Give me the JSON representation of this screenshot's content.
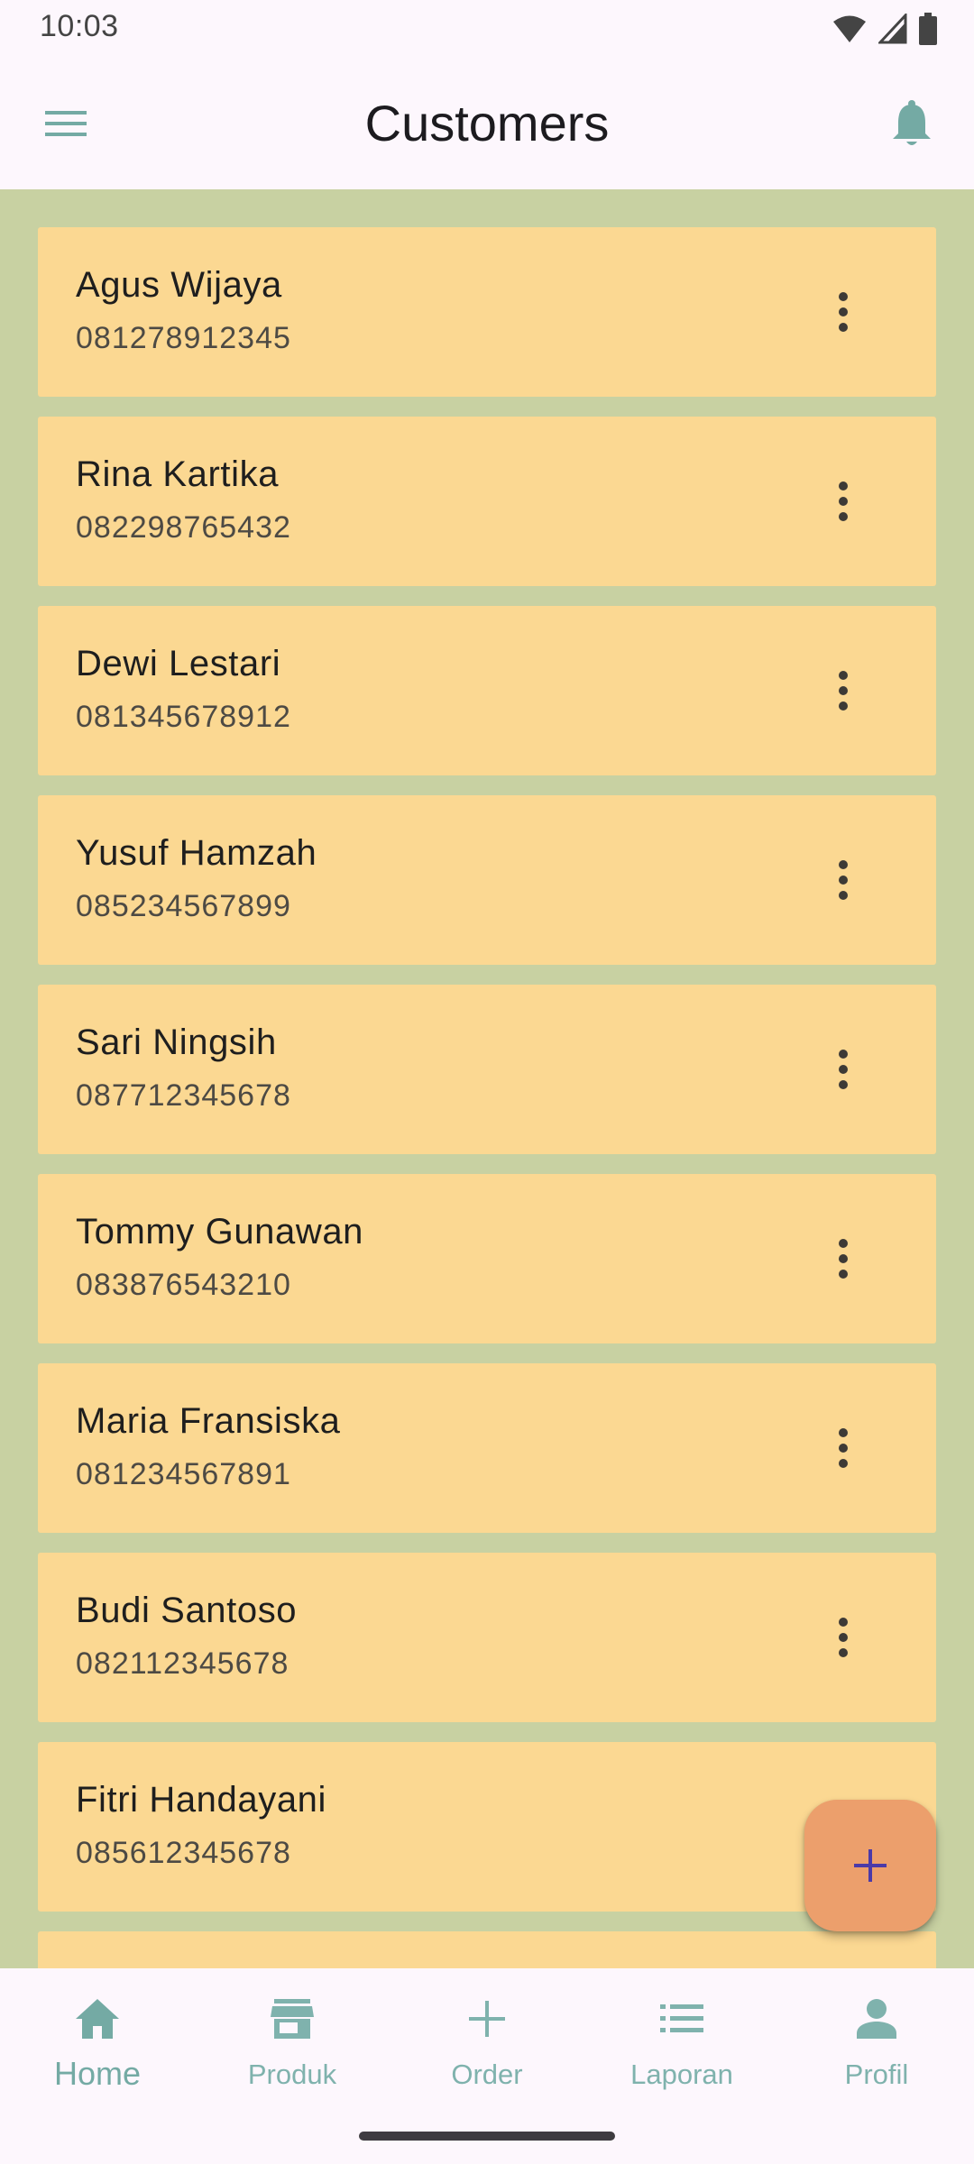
{
  "status_bar": {
    "time": "10:03"
  },
  "app_bar": {
    "title": "Customers"
  },
  "customers": [
    {
      "name": "Agus Wijaya",
      "phone": "081278912345"
    },
    {
      "name": "Rina Kartika",
      "phone": "082298765432"
    },
    {
      "name": "Dewi Lestari",
      "phone": "081345678912"
    },
    {
      "name": "Yusuf Hamzah",
      "phone": "085234567899"
    },
    {
      "name": "Sari Ningsih",
      "phone": "087712345678"
    },
    {
      "name": "Tommy Gunawan",
      "phone": "083876543210"
    },
    {
      "name": "Maria Fransiska",
      "phone": "081234567891"
    },
    {
      "name": "Budi Santoso",
      "phone": "082112345678"
    },
    {
      "name": "Fitri Handayani",
      "phone": "085612345678"
    },
    {
      "name": "",
      "phone": ""
    }
  ],
  "fab": {
    "icon": "plus-icon"
  },
  "bottom_nav": {
    "items": [
      {
        "label": "Home",
        "icon": "home-icon",
        "active": true
      },
      {
        "label": "Produk",
        "icon": "store-icon",
        "active": false
      },
      {
        "label": "Order",
        "icon": "plus-icon",
        "active": false
      },
      {
        "label": "Laporan",
        "icon": "list-icon",
        "active": false
      },
      {
        "label": "Profil",
        "icon": "person-icon",
        "active": false
      }
    ]
  },
  "colors": {
    "background": "#fdf7fd",
    "list_background": "#c8d1a2",
    "card": "#fbd892",
    "fab": "#ec9f6c",
    "accent": "#74aaa4",
    "fab_icon": "#4b3aa8"
  }
}
